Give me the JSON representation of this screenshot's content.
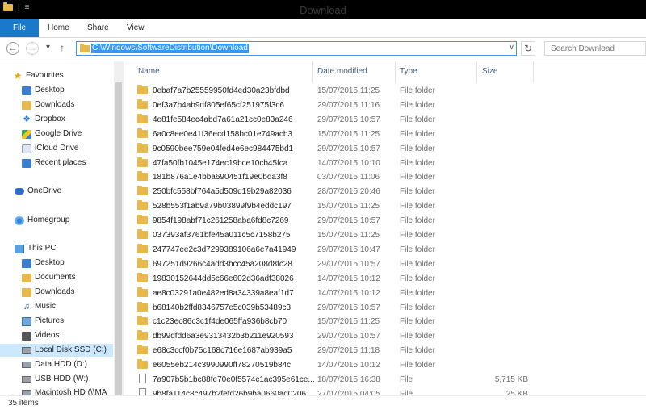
{
  "window": {
    "title": "Download"
  },
  "ribbon": {
    "tabs": [
      "File",
      "Home",
      "Share",
      "View"
    ]
  },
  "address": {
    "path": "C:\\Windows\\SoftwareDistribution\\Download"
  },
  "search": {
    "placeholder": "Search Download"
  },
  "columns": {
    "name": "Name",
    "date": "Date modified",
    "type": "Type",
    "size": "Size"
  },
  "nav": {
    "favourites_label": "Favourites",
    "favourites": [
      "Desktop",
      "Downloads",
      "Dropbox",
      "Google Drive",
      "iCloud Drive",
      "Recent places"
    ],
    "onedrive": "OneDrive",
    "homegroup": "Homegroup",
    "thispc_label": "This PC",
    "thispc": [
      "Desktop",
      "Documents",
      "Downloads",
      "Music",
      "Pictures",
      "Videos",
      "Local Disk SSD (C:)",
      "Data HDD (D:)",
      "USB HDD (W:)",
      "Macintosh HD (\\\\MA"
    ]
  },
  "files": [
    {
      "name": "0ebaf7a7b25559950fd4ed30a23bfdbd",
      "date": "15/07/2015 11:25",
      "type": "File folder",
      "size": "",
      "kind": "folder"
    },
    {
      "name": "0ef3a7b4ab9df805ef65cf251975f3c6",
      "date": "29/07/2015 11:16",
      "type": "File folder",
      "size": "",
      "kind": "folder"
    },
    {
      "name": "4e81fe584ec4abd7a61a21cc0e83a246",
      "date": "29/07/2015 10:57",
      "type": "File folder",
      "size": "",
      "kind": "folder"
    },
    {
      "name": "6a0c8ee0e41f36ecd158bc01e749acb3",
      "date": "15/07/2015 11:25",
      "type": "File folder",
      "size": "",
      "kind": "folder"
    },
    {
      "name": "9c0590bee759e04fed4e6ec984475bd1",
      "date": "29/07/2015 10:57",
      "type": "File folder",
      "size": "",
      "kind": "folder"
    },
    {
      "name": "47fa50fb1045e174ec19bce10cb45fca",
      "date": "14/07/2015 10:10",
      "type": "File folder",
      "size": "",
      "kind": "folder"
    },
    {
      "name": "181b876a1e4bba690451f19e0bda3f8",
      "date": "03/07/2015 11:06",
      "type": "File folder",
      "size": "",
      "kind": "folder"
    },
    {
      "name": "250bfc558bf764a5d509d19b29a82036",
      "date": "28/07/2015 20:46",
      "type": "File folder",
      "size": "",
      "kind": "folder"
    },
    {
      "name": "528b553f1ab9a79b03899f9b4eddc197",
      "date": "15/07/2015 11:25",
      "type": "File folder",
      "size": "",
      "kind": "folder"
    },
    {
      "name": "9854f198abf71c261258aba6fd8c7269",
      "date": "29/07/2015 10:57",
      "type": "File folder",
      "size": "",
      "kind": "folder"
    },
    {
      "name": "037393af3761bfe45a011c5c7158b275",
      "date": "15/07/2015 11:25",
      "type": "File folder",
      "size": "",
      "kind": "folder"
    },
    {
      "name": "247747ee2c3d7299389106a6e7a41949",
      "date": "29/07/2015 10:47",
      "type": "File folder",
      "size": "",
      "kind": "folder"
    },
    {
      "name": "697251d9266c4add3bcc45a208d8fc28",
      "date": "29/07/2015 10:57",
      "type": "File folder",
      "size": "",
      "kind": "folder"
    },
    {
      "name": "19830152644dd5c66e602d36adf38026",
      "date": "14/07/2015 10:12",
      "type": "File folder",
      "size": "",
      "kind": "folder"
    },
    {
      "name": "ae8c03291a0e482ed8a34339a8eaf1d7",
      "date": "14/07/2015 10:12",
      "type": "File folder",
      "size": "",
      "kind": "folder"
    },
    {
      "name": "b68140b2ffd8346757e5c039b53489c3",
      "date": "29/07/2015 10:57",
      "type": "File folder",
      "size": "",
      "kind": "folder"
    },
    {
      "name": "c1c23ec86c3c1f4de065ffa936b8cb70",
      "date": "15/07/2015 11:25",
      "type": "File folder",
      "size": "",
      "kind": "folder"
    },
    {
      "name": "db99dfdd6a3e9313432b3b211e920593",
      "date": "29/07/2015 10:57",
      "type": "File folder",
      "size": "",
      "kind": "folder"
    },
    {
      "name": "e68c3ccf0b75c168c716e1687ab939a5",
      "date": "29/07/2015 11:18",
      "type": "File folder",
      "size": "",
      "kind": "folder"
    },
    {
      "name": "e6055eb214c3990990ff78270519b84c",
      "date": "14/07/2015 10:12",
      "type": "File folder",
      "size": "",
      "kind": "folder"
    },
    {
      "name": "7a907b5b1bc88fe70e0f5574c1ac395e61ce...",
      "date": "18/07/2015 16:38",
      "type": "File",
      "size": "5,715 KB",
      "kind": "file"
    },
    {
      "name": "9b8fa114c8c497b2fefd26b9ba0660ad0206",
      "date": "27/07/2015 04:05",
      "type": "File",
      "size": "25 KB",
      "kind": "file"
    }
  ],
  "status": {
    "count": "35 items"
  }
}
